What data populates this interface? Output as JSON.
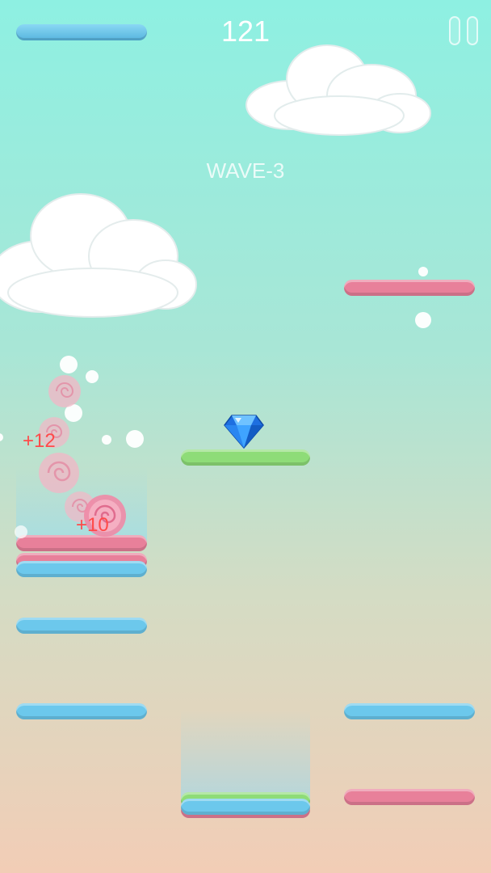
{
  "hud": {
    "score": "121",
    "wave_label": "WAVE-3",
    "pause_icon": "pause-icon"
  },
  "popups": [
    {
      "text": "+12"
    },
    {
      "text": "+10"
    }
  ],
  "colors": {
    "platform_blue": "#6cc8ec",
    "platform_pink": "#e8809a",
    "platform_green": "#8edc78",
    "score_popup": "#ff4a4a",
    "sky_top": "#8ef0e2",
    "sky_bottom": "#f2cdb6"
  },
  "items": {
    "gem": "diamond-gem-icon",
    "candy": "lollipop-icon"
  }
}
